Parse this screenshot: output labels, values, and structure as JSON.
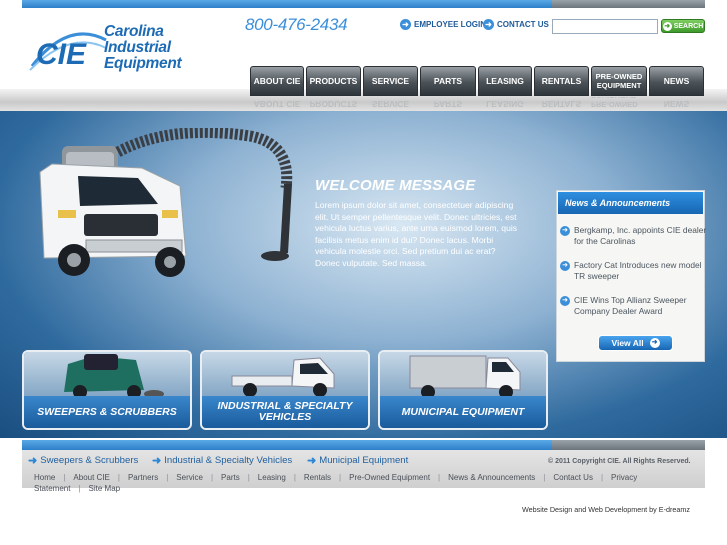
{
  "header": {
    "logo_mark": "CIE",
    "logo_words": [
      "Carolina",
      "Industrial",
      "Equipment"
    ],
    "phone": "800-476-2434",
    "employee_login": "EMPLOYEE LOGIN",
    "contact_us": "CONTACT US",
    "search_placeholder": "",
    "search_button": "SEARCH"
  },
  "nav": {
    "items": [
      {
        "label": "ABOUT CIE"
      },
      {
        "label": "PRODUCTS"
      },
      {
        "label": "SERVICE"
      },
      {
        "label": "PARTS"
      },
      {
        "label": "LEASING"
      },
      {
        "label": "RENTALS"
      },
      {
        "label": "PRE-OWNED EQUIPMENT"
      },
      {
        "label": "NEWS"
      }
    ]
  },
  "welcome": {
    "title": "WELCOME MESSAGE",
    "body": "Lorem ipsum dolor sit amet, consectetuer adipiscing elit. Ut semper pellentesque velit. Donec ultricies, est vehicula luctus varius, ante urna euismod lorem, quis facilisis metus enim id dui? Donec lacus. Morbi vehicula molestie orci. Sed pretium dui ac erat? Donec vulputate. Sed massa."
  },
  "news": {
    "title": "News & Announcements",
    "items": [
      "Bergkamp, Inc. appoints CIE dealer for the Carolinas",
      "Factory Cat Introduces new model TR sweeper",
      "CIE Wins Top Allianz Sweeper Company Dealer Award"
    ],
    "view_all": "View All"
  },
  "cards": [
    {
      "label": "SWEEPERS & SCRUBBERS"
    },
    {
      "label": "INDUSTRIAL & SPECIALTY VEHICLES"
    },
    {
      "label": "MUNICIPAL EQUIPMENT"
    }
  ],
  "footer": {
    "links": [
      "Sweepers & Scrubbers",
      "Industrial & Specialty Vehicles",
      "Municipal Equipment"
    ],
    "copyright": "© 2011 Copyright CIE. All Rights Reserved.",
    "nav": [
      "Home",
      "About CIE",
      "Partners",
      "Service",
      "Parts",
      "Leasing",
      "Rentals",
      "Pre-Owned Equipment",
      "News & Announcements",
      "Contact Us",
      "Privacy Statement",
      "Site Map"
    ],
    "credit": "Website Design and Web Development by E-dreamz"
  },
  "colors": {
    "brand_blue": "#1d6bb5",
    "accent_blue": "#3b8fd9",
    "search_green": "#3e9a2a",
    "nav_dark": "#2f363b"
  }
}
